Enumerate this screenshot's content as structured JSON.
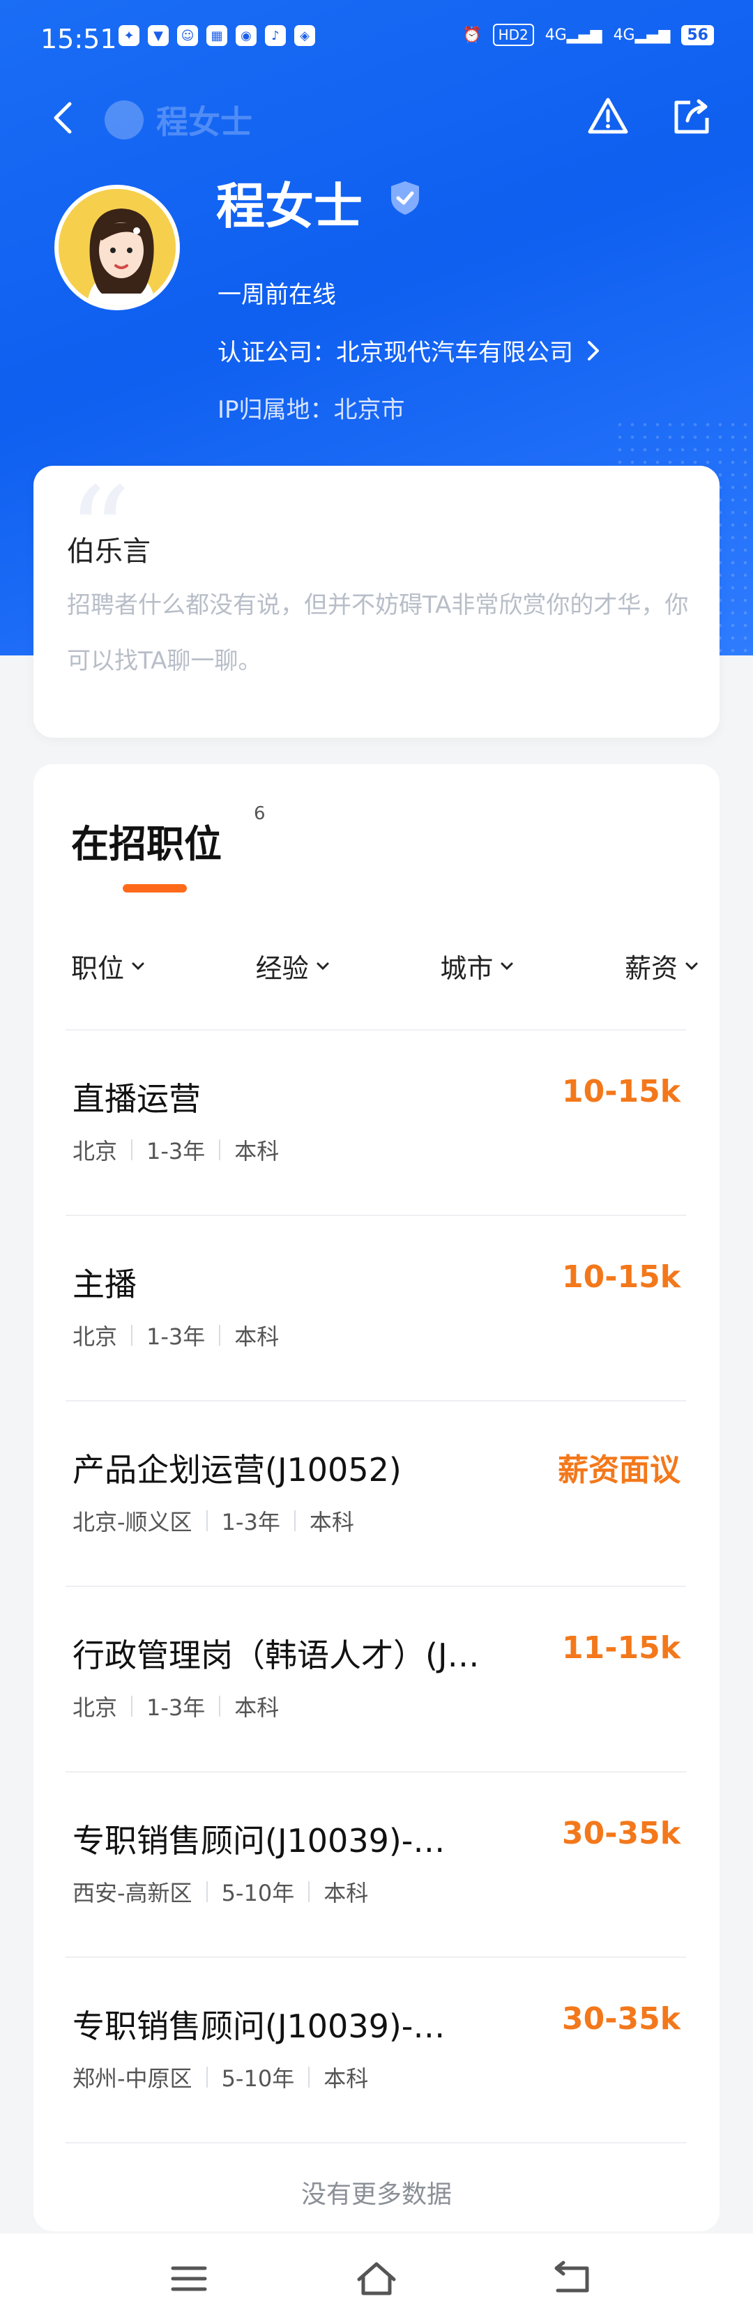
{
  "status_bar": {
    "time": "15:51",
    "apps": [
      "app-1",
      "app-2",
      "app-3",
      "app-4",
      "app-5",
      "app-6",
      "app-7"
    ],
    "right_hd": "HD2",
    "network_1": "4G",
    "network_2": "4G",
    "battery": "56"
  },
  "nav": {
    "title": "程女士"
  },
  "profile": {
    "name": "程女士",
    "online_status": "一周前在线",
    "company_label": "认证公司：",
    "company_name": "北京现代汽车有限公司",
    "ip_label": "IP归属地：",
    "ip_location": "北京市"
  },
  "intro": {
    "title": "伯乐言",
    "text": "招聘者什么都没有说，但并不妨碍TA非常欣赏你的才华，你可以找TA聊一聊。"
  },
  "jobs": {
    "title": "在招职位",
    "count": "6",
    "filters": [
      "职位",
      "经验",
      "城市",
      "薪资"
    ],
    "items": [
      {
        "title": "直播运营",
        "salary": "10-15k",
        "location": "北京",
        "experience": "1-3年",
        "education": "本科"
      },
      {
        "title": "主播",
        "salary": "10-15k",
        "location": "北京",
        "experience": "1-3年",
        "education": "本科"
      },
      {
        "title": "产品企划运营(J10052)",
        "salary": "薪资面议",
        "location": "北京-顺义区",
        "experience": "1-3年",
        "education": "本科"
      },
      {
        "title": "行政管理岗（韩语人才）(J…",
        "salary": "11-15k",
        "location": "北京",
        "experience": "1-3年",
        "education": "本科"
      },
      {
        "title": "专职销售顾问(J10039)-…",
        "salary": "30-35k",
        "location": "西安-高新区",
        "experience": "5-10年",
        "education": "本科"
      },
      {
        "title": "专职销售顾问(J10039)-…",
        "salary": "30-35k",
        "location": "郑州-中原区",
        "experience": "5-10年",
        "education": "本科"
      }
    ],
    "no_more": "没有更多数据"
  },
  "colors": {
    "header_blue": "#1a6df5",
    "salary_orange": "#f3781b",
    "accent_underline": "#ff6a1a"
  }
}
